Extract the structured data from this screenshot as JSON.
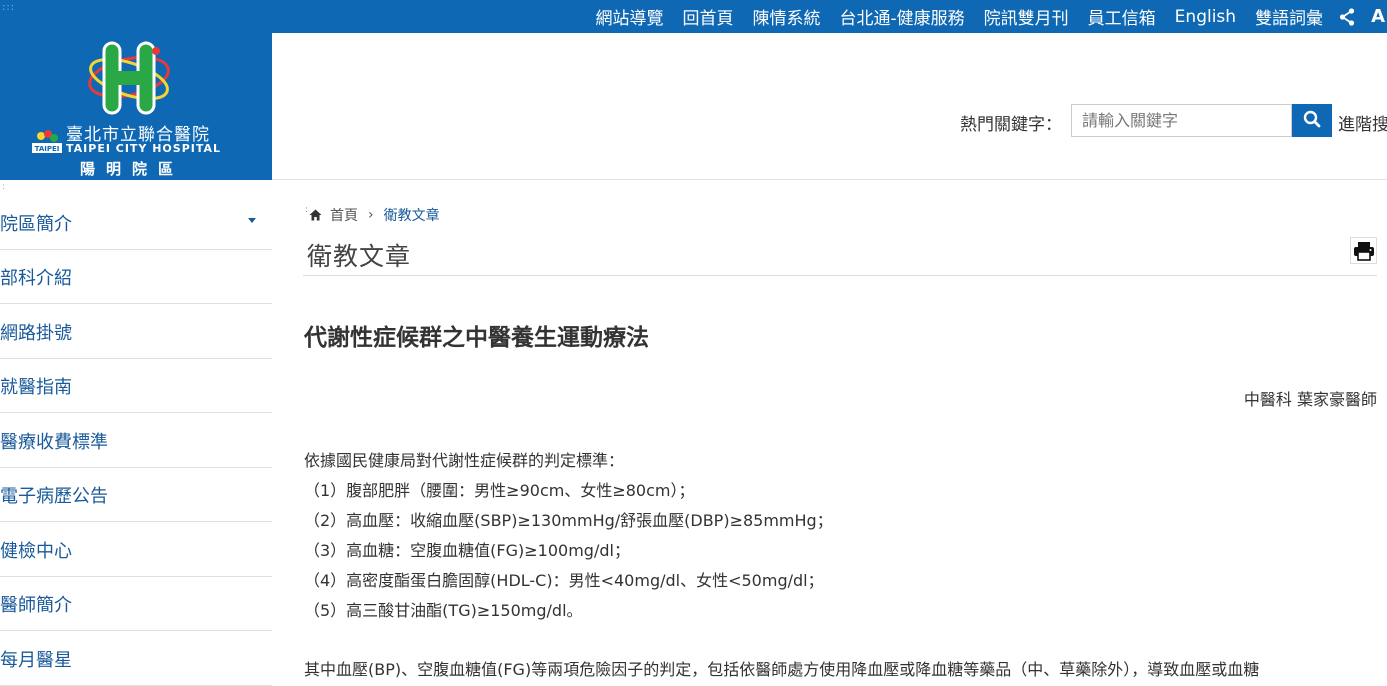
{
  "topnav": {
    "items": [
      "網站導覽",
      "回首頁",
      "陳情系統",
      "台北通-健康服務",
      "院訊雙月刊",
      "員工信箱",
      "English",
      "雙語詞彙"
    ],
    "share_icon": "share-icon",
    "font_icon_label": "A"
  },
  "logo": {
    "letter": "H",
    "name": "臺北市立聯合醫院",
    "english": "TAIPEI CITY HOSPITAL",
    "branch": "陽明院區",
    "badge_text": "TAIPEI"
  },
  "search": {
    "label": "熱門關鍵字：",
    "placeholder": "請輸入關鍵字",
    "advanced": "進階搜"
  },
  "sidebar": {
    "items": [
      {
        "label": "院區簡介"
      },
      {
        "label": "部科介紹"
      },
      {
        "label": "網路掛號"
      },
      {
        "label": "就醫指南"
      },
      {
        "label": "醫療收費標準"
      },
      {
        "label": "電子病歷公告"
      },
      {
        "label": "健檢中心"
      },
      {
        "label": "醫師簡介"
      },
      {
        "label": "每月醫星"
      }
    ]
  },
  "breadcrumb": {
    "home": "首頁",
    "separator": "›",
    "current": "衛教文章"
  },
  "page_title": "衛教文章",
  "article": {
    "title": "代謝性症候群之中醫養生運動療法",
    "author": "中醫科 葉家豪醫師",
    "lines": [
      "依據國民健康局對代謝性症候群的判定標準：",
      "（1）腹部肥胖（腰圍：男性≥90cm、女性≥80cm）；",
      "（2）高血壓：收縮血壓(SBP)≥130mmHg/舒張血壓(DBP)≥85mmHg；",
      "（3）高血糖：空腹血糖值(FG)≥100mg/dl；",
      "（4）高密度酯蛋白膽固醇(HDL-C)：男性<40mg/dl、女性<50mg/dl；",
      "（5）高三酸甘油酯(TG)≥150mg/dl。"
    ],
    "para2": "其中血壓(BP)、空腹血糖值(FG)等兩項危險因子的判定，包括依醫師處方使用降血壓或降血糖等藥品（中、草藥除外），導致血壓或血糖"
  },
  "colors": {
    "brand_blue": "#0f68b4",
    "link_blue": "#1a5a9a"
  }
}
